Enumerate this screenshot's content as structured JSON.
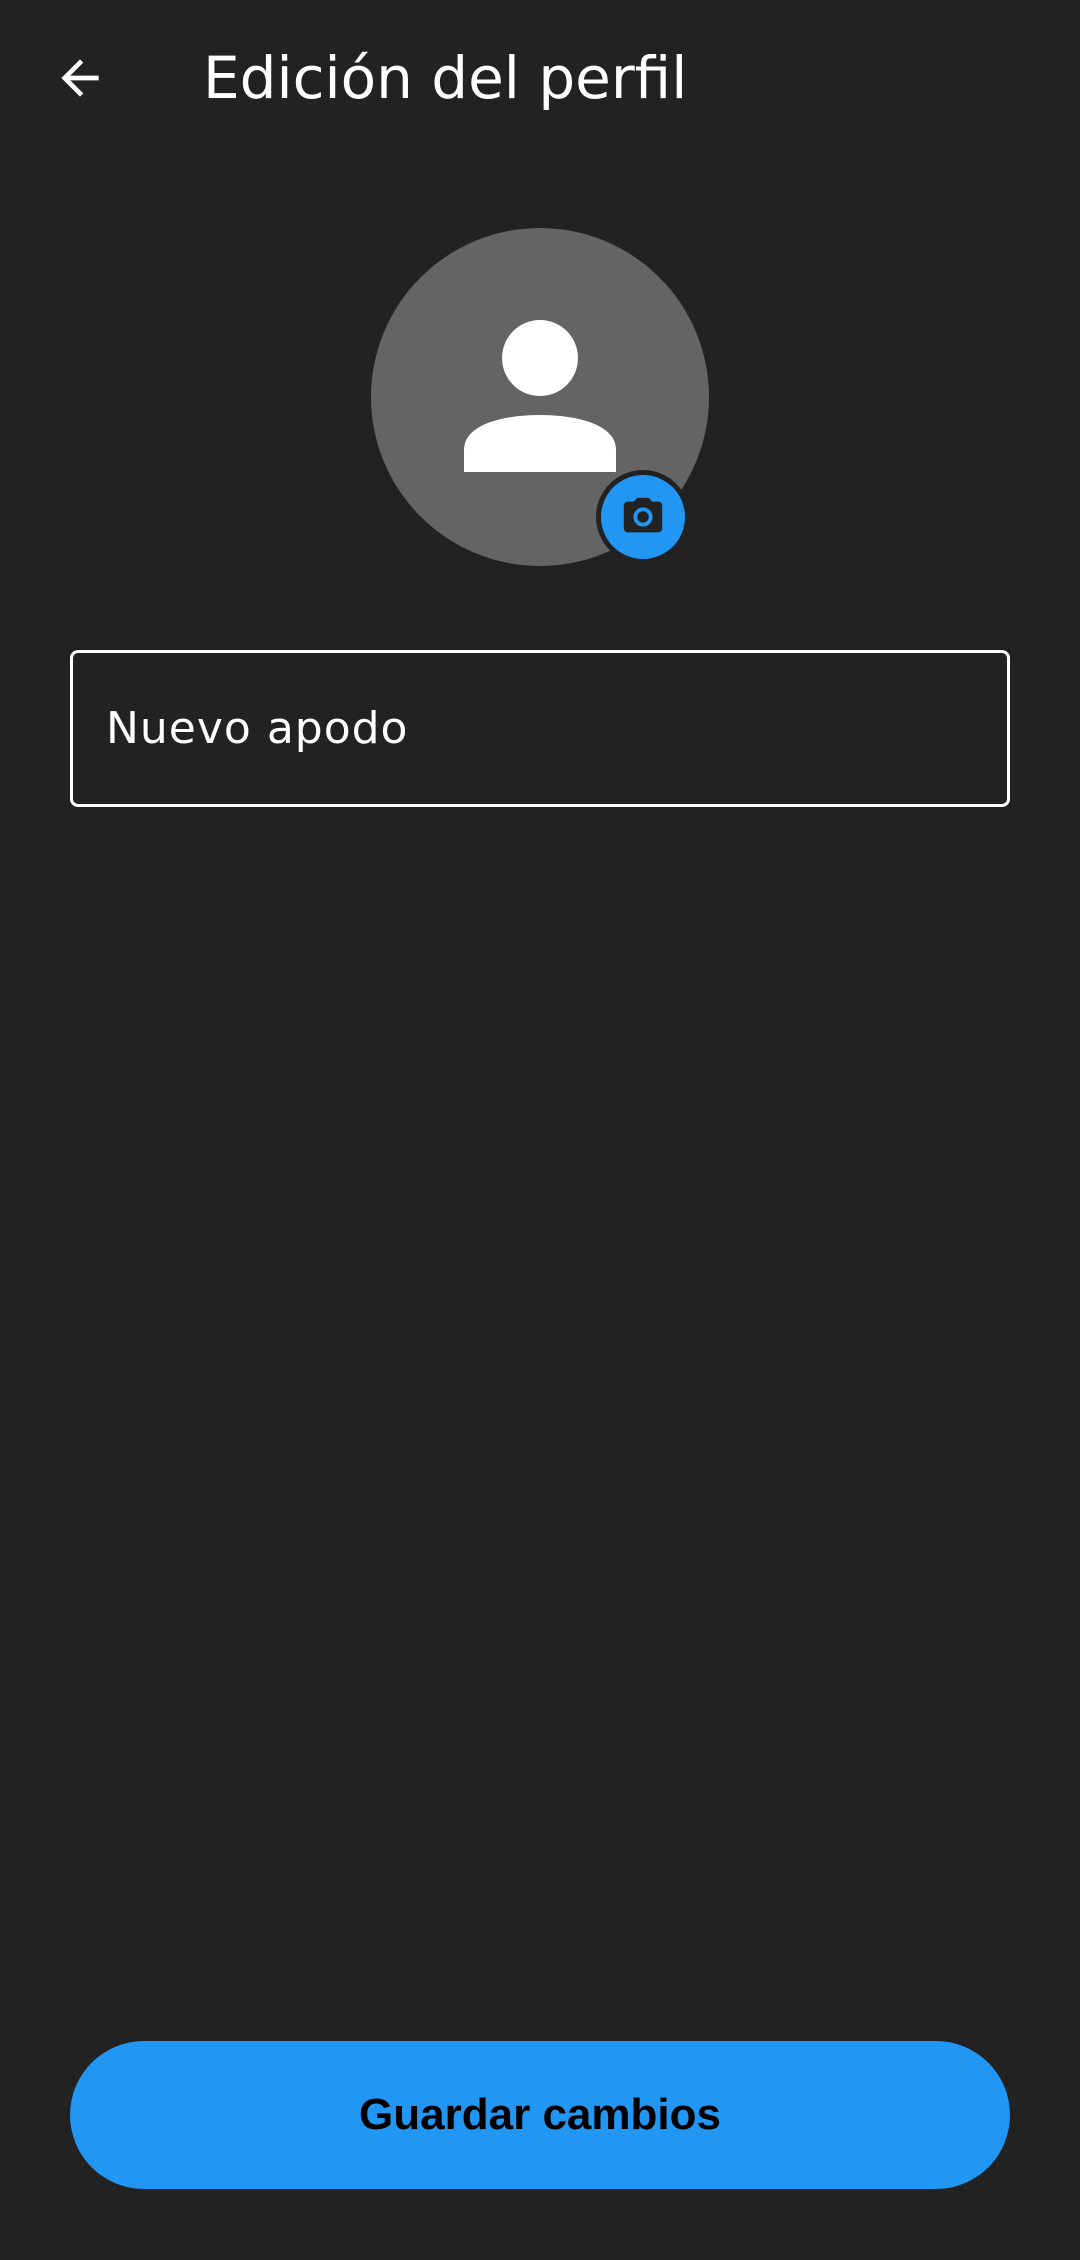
{
  "header": {
    "title": "Edición del perfil",
    "back_icon": "arrow-back-icon"
  },
  "avatar": {
    "icon": "person-icon",
    "badge_icon": "camera-icon",
    "badge_color": "#2196f3",
    "background_color": "#646464"
  },
  "form": {
    "nickname_placeholder": "Nuevo apodo",
    "nickname_value": ""
  },
  "footer": {
    "save_label": "Guardar cambios",
    "accent_color": "#2196f3"
  },
  "theme": {
    "background": "#222222",
    "text": "#ffffff"
  }
}
